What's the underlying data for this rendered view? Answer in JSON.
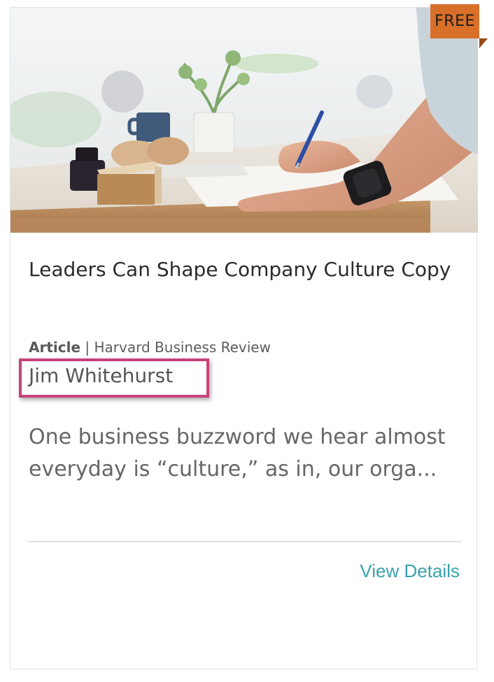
{
  "card": {
    "badge": "FREE",
    "image_alt": "Person writing at a table",
    "title": "Leaders Can Shape Company Culture Copy",
    "type": "Article",
    "separator": "|",
    "source": "Harvard Business Review",
    "author": "Jim Whitehurst",
    "description": "One business buzzword we hear almost everyday is “culture,” as in, our orga...",
    "cta": "View Details"
  },
  "colors": {
    "badge": "#d9702a",
    "highlight_box": "#c8427a",
    "link": "#3aa1ad"
  }
}
